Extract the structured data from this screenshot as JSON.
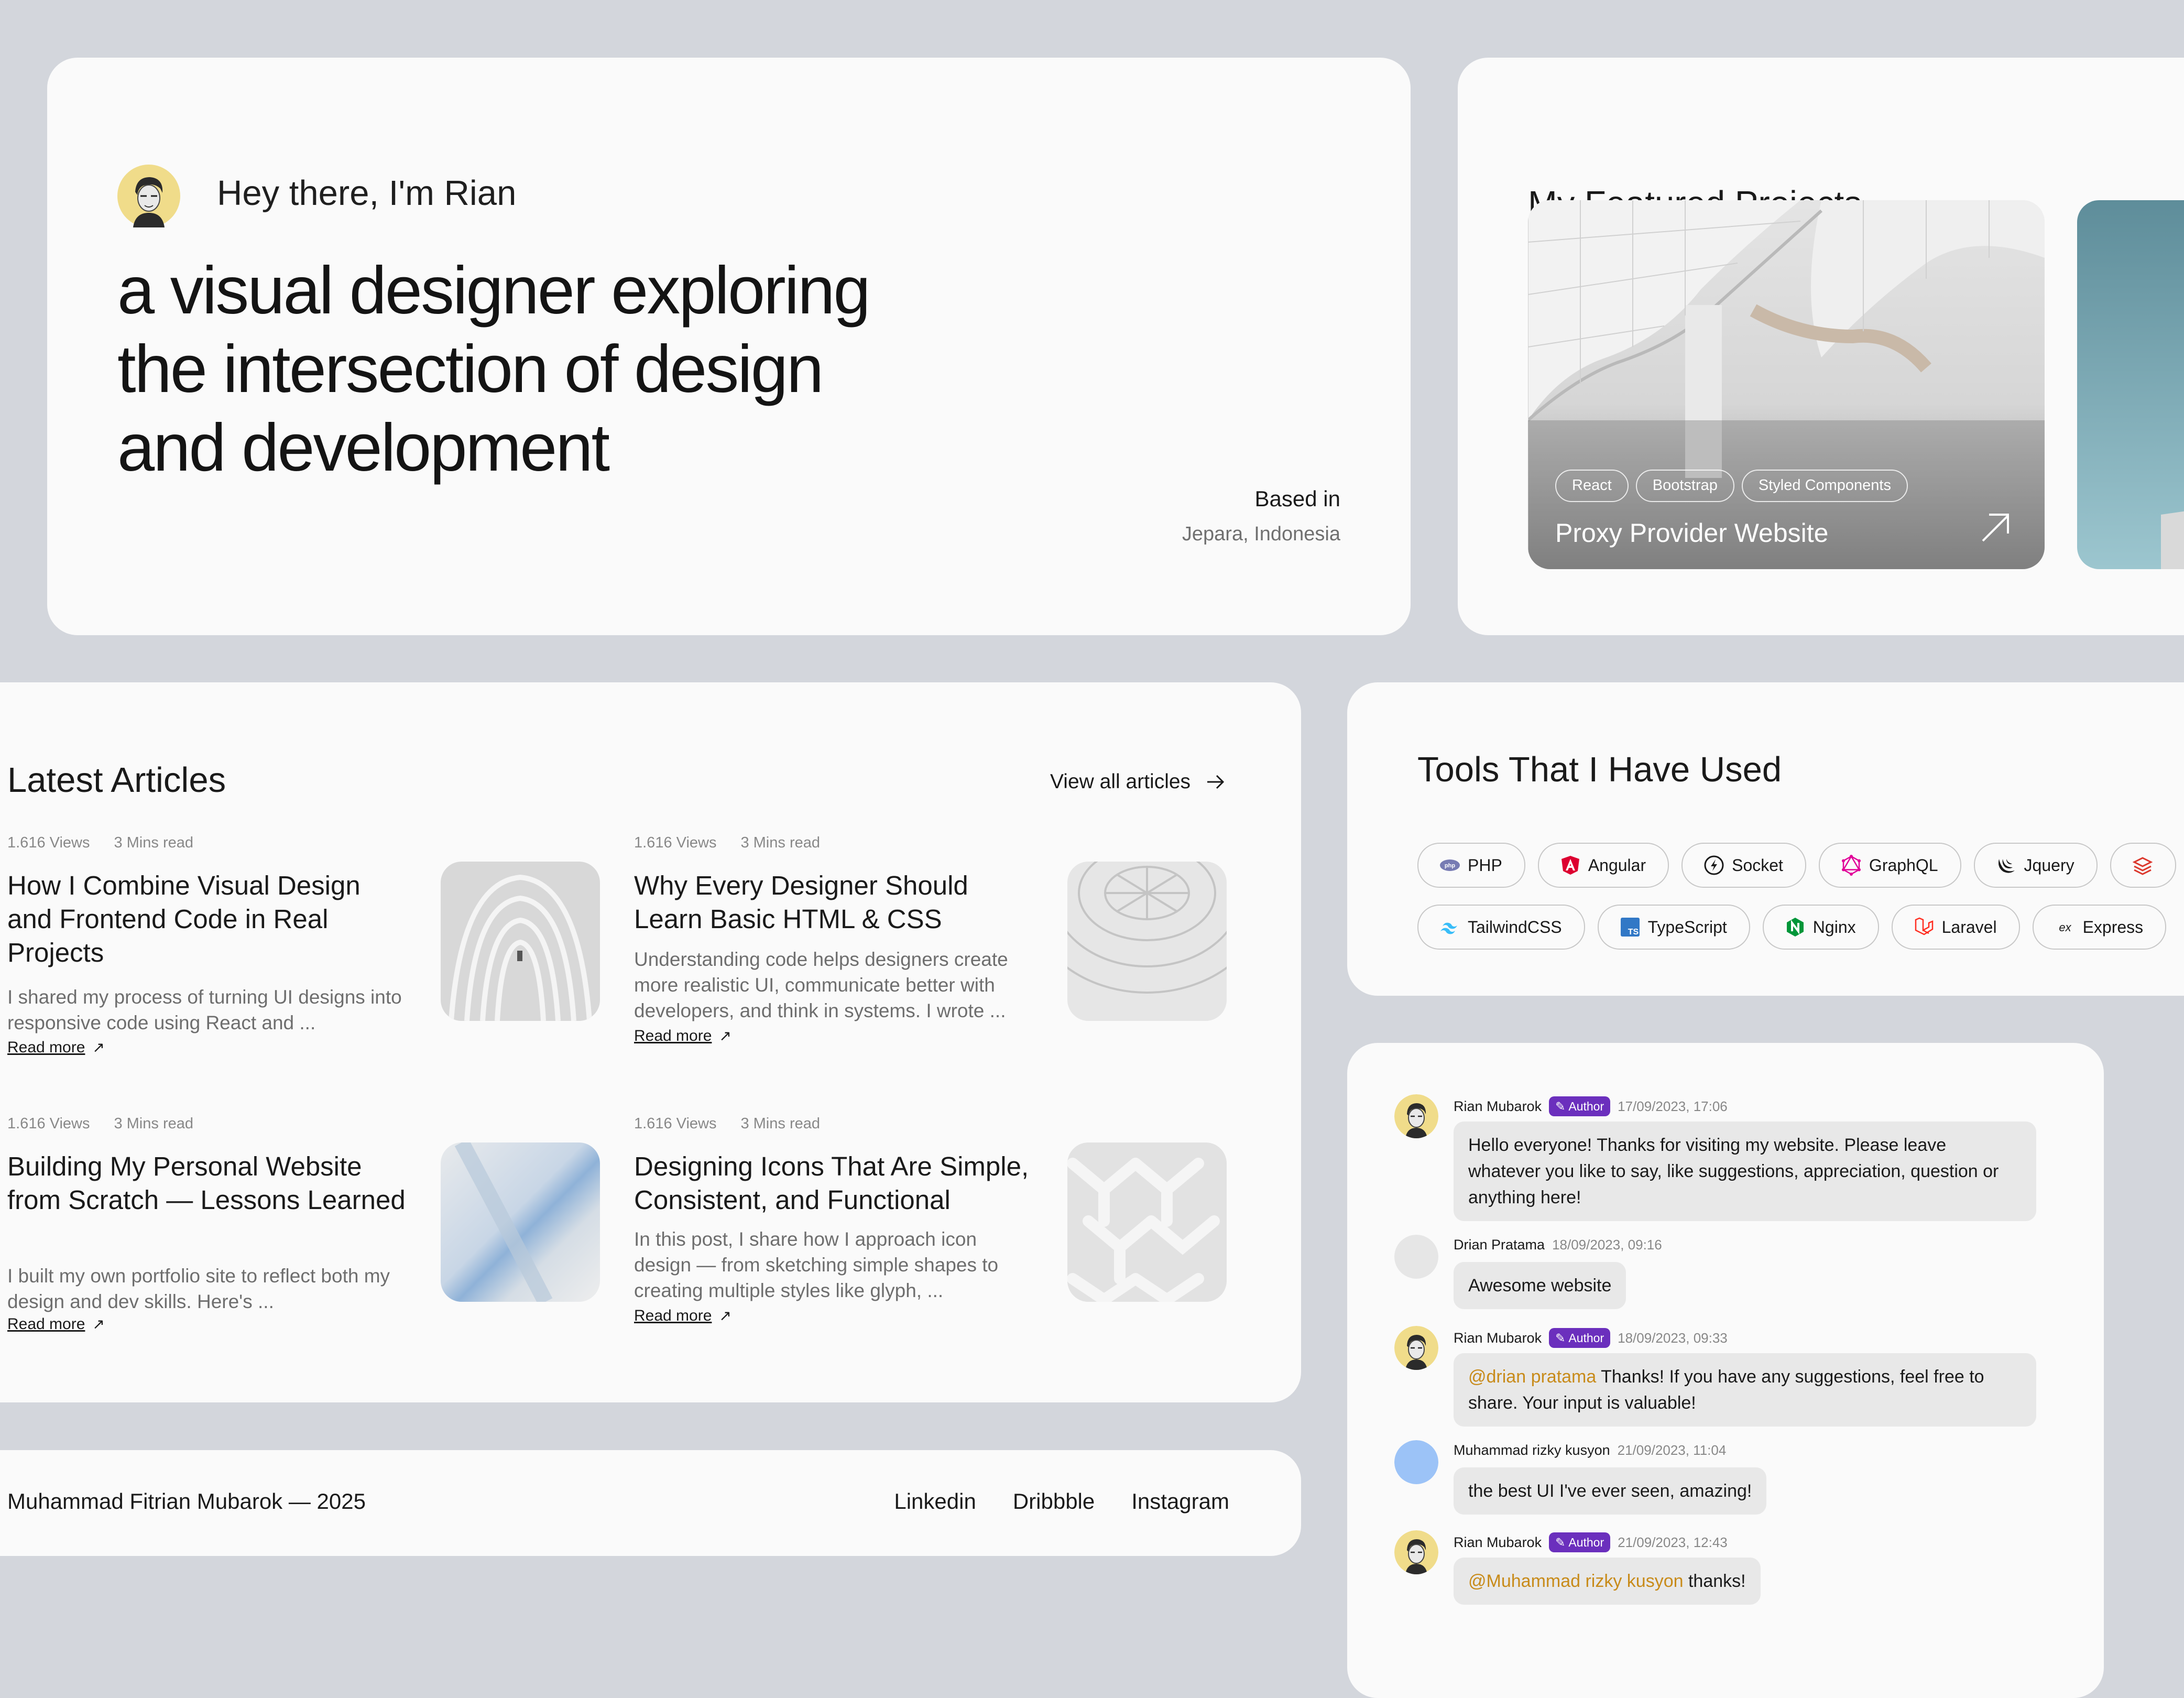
{
  "hero": {
    "greeting": "Hey there, I'm Rian",
    "headline_lines": [
      "a visual designer exploring",
      "the intersection of design",
      "and development"
    ],
    "based_label": "Based in",
    "based_value": "Jepara, Indonesia"
  },
  "featured": {
    "title": "My Featured Projects",
    "projects": [
      {
        "name": "Proxy Provider Website",
        "tags": [
          "React",
          "Bootstrap",
          "Styled Components"
        ]
      }
    ]
  },
  "articles": {
    "title": "Latest Articles",
    "view_all": "View all articles",
    "items": [
      {
        "views": "1.616 Views",
        "read_time": "3 Mins read",
        "title": "How I Combine Visual Design and Frontend Code in Real Projects",
        "excerpt": "I shared my process of turning UI designs into responsive code using React and ...",
        "read_more": "Read more"
      },
      {
        "views": "1.616 Views",
        "read_time": "3 Mins read",
        "title": "Why Every Designer Should Learn Basic HTML & CSS",
        "excerpt": "Understanding code helps designers create more realistic UI, communicate better with developers, and think in systems. I wrote ...",
        "read_more": "Read more"
      },
      {
        "views": "1.616 Views",
        "read_time": "3 Mins read",
        "title": "Building My Personal Website from Scratch — Lessons Learned",
        "excerpt": "I built my own portfolio site to reflect both my design and dev skills. Here's ...",
        "read_more": "Read more"
      },
      {
        "views": "1.616 Views",
        "read_time": "3 Mins read",
        "title": "Designing Icons That Are Simple, Consistent, and Functional",
        "excerpt": "In this post, I share how I approach icon design — from sketching simple shapes to creating multiple styles like glyph, ...",
        "read_more": "Read more"
      }
    ]
  },
  "footer": {
    "copyright": "Muhammad Fitrian Mubarok — 2025",
    "links": [
      "Linkedin",
      "Dribbble",
      "Instagram"
    ]
  },
  "tools": {
    "title": "Tools That I Have Used",
    "row1": [
      {
        "label": "PHP",
        "icon": "php-icon"
      },
      {
        "label": "Angular",
        "icon": "angular-icon"
      },
      {
        "label": "Socket",
        "icon": "socket-icon"
      },
      {
        "label": "GraphQL",
        "icon": "graphql-icon"
      },
      {
        "label": "Jquery",
        "icon": "jquery-icon"
      }
    ],
    "row2": [
      {
        "label": "TailwindCSS",
        "icon": "tailwind-icon"
      },
      {
        "label": "TypeScript",
        "icon": "typescript-icon"
      },
      {
        "label": "Nginx",
        "icon": "nginx-icon"
      },
      {
        "label": "Laravel",
        "icon": "laravel-icon"
      },
      {
        "label": "Express",
        "icon": "express-icon"
      }
    ],
    "colors": {
      "php": "#777bb3",
      "angular": "#dd0031",
      "graphql": "#e10098",
      "tailwind": "#38bdf8",
      "typescript": "#3178c6",
      "nginx": "#009639",
      "laravel": "#ff2d20"
    }
  },
  "comments": {
    "author_badge": "Author",
    "items": [
      {
        "name": "Rian Mubarok",
        "is_author": true,
        "time": "17/09/2023, 17:06",
        "text": "Hello everyone! Thanks for visiting my website. Please leave whatever you like to say, like suggestions, appreciation, question or anything here!"
      },
      {
        "name": "Drian Pratama",
        "is_author": false,
        "time": "18/09/2023, 09:16",
        "text": "Awesome website"
      },
      {
        "name": "Rian Mubarok",
        "is_author": true,
        "time": "18/09/2023, 09:33",
        "mention": "@drian pratama",
        "text": " Thanks! If you have any suggestions, feel free to share. Your input is valuable!"
      },
      {
        "name": "Muhammad rizky kusyon",
        "is_author": false,
        "time": "21/09/2023, 11:04",
        "text": "the best UI I've ever seen, amazing!"
      },
      {
        "name": "Rian Mubarok",
        "is_author": true,
        "time": "21/09/2023, 12:43",
        "mention": "@Muhammad rizky kusyon",
        "text": " thanks!"
      }
    ]
  },
  "colors": {
    "background": "#d3d6dc",
    "card": "#fafafa",
    "author_badge": "#6b2fbd",
    "mention": "#c88b1a",
    "bubble": "#e8e8e8"
  }
}
